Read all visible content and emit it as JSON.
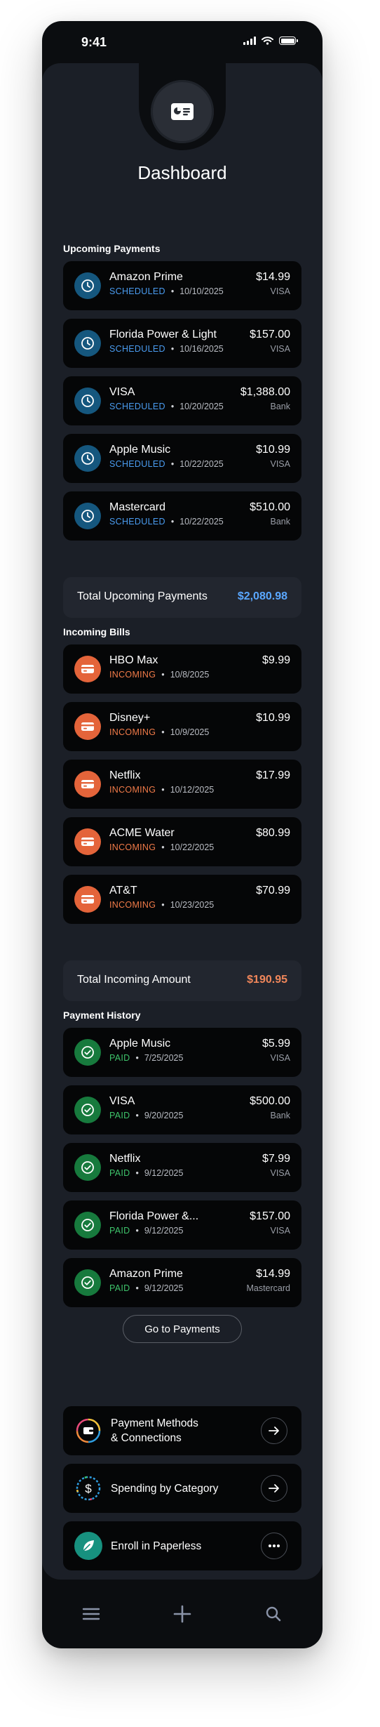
{
  "status_bar": {
    "time": "9:41"
  },
  "header": {
    "title": "Dashboard",
    "icon": "wallet-card-icon"
  },
  "upcoming": {
    "label": "Upcoming Payments",
    "items": [
      {
        "name": "Amazon Prime",
        "status": "SCHEDULED",
        "date": "10/10/2025",
        "amount": "$14.99",
        "method": "VISA"
      },
      {
        "name": "Florida Power & Light",
        "status": "SCHEDULED",
        "date": "10/16/2025",
        "amount": "$157.00",
        "method": "VISA"
      },
      {
        "name": "VISA",
        "status": "SCHEDULED",
        "date": "10/20/2025",
        "amount": "$1,388.00",
        "method": "Bank"
      },
      {
        "name": "Apple Music",
        "status": "SCHEDULED",
        "date": "10/22/2025",
        "amount": "$10.99",
        "method": "VISA"
      },
      {
        "name": "Mastercard",
        "status": "SCHEDULED",
        "date": "10/22/2025",
        "amount": "$510.00",
        "method": "Bank"
      }
    ],
    "total_label": "Total Upcoming Payments",
    "total_value": "$2,080.98"
  },
  "incoming": {
    "label": "Incoming Bills",
    "items": [
      {
        "name": "HBO Max",
        "status": "INCOMING",
        "date": "10/8/2025",
        "amount": "$9.99"
      },
      {
        "name": "Disney+",
        "status": "INCOMING",
        "date": "10/9/2025",
        "amount": "$10.99"
      },
      {
        "name": "Netflix",
        "status": "INCOMING",
        "date": "10/12/2025",
        "amount": "$17.99"
      },
      {
        "name": "ACME Water",
        "status": "INCOMING",
        "date": "10/22/2025",
        "amount": "$80.99"
      },
      {
        "name": "AT&T",
        "status": "INCOMING",
        "date": "10/23/2025",
        "amount": "$70.99"
      }
    ],
    "total_label": "Total Incoming Amount",
    "total_value": "$190.95"
  },
  "history": {
    "label": "Payment History",
    "items": [
      {
        "name": "Apple Music",
        "status": "PAID",
        "date": "7/25/2025",
        "amount": "$5.99",
        "method": "VISA"
      },
      {
        "name": "VISA",
        "status": "PAID",
        "date": "9/20/2025",
        "amount": "$500.00",
        "method": "Bank"
      },
      {
        "name": "Netflix",
        "status": "PAID",
        "date": "9/12/2025",
        "amount": "$7.99",
        "method": "VISA"
      },
      {
        "name": "Florida Power &...",
        "status": "PAID",
        "date": "9/12/2025",
        "amount": "$157.00",
        "method": "VISA"
      },
      {
        "name": "Amazon Prime",
        "status": "PAID",
        "date": "9/12/2025",
        "amount": "$14.99",
        "method": "Mastercard"
      }
    ]
  },
  "go_button": "Go to Payments",
  "links": [
    {
      "line1": "Payment Methods",
      "line2": "& Connections",
      "action": "arrow"
    },
    {
      "line1": "Spending by Category",
      "line2": "",
      "action": "arrow"
    },
    {
      "line1": "Enroll in Paperless",
      "line2": "",
      "action": "more"
    }
  ],
  "dot": "•",
  "colors": {
    "scheduled": "#4a9cf0",
    "incoming": "#f07a48",
    "paid": "#3ec46b",
    "upcoming_total": "#5aa7ff",
    "incoming_total": "#f0865a"
  }
}
